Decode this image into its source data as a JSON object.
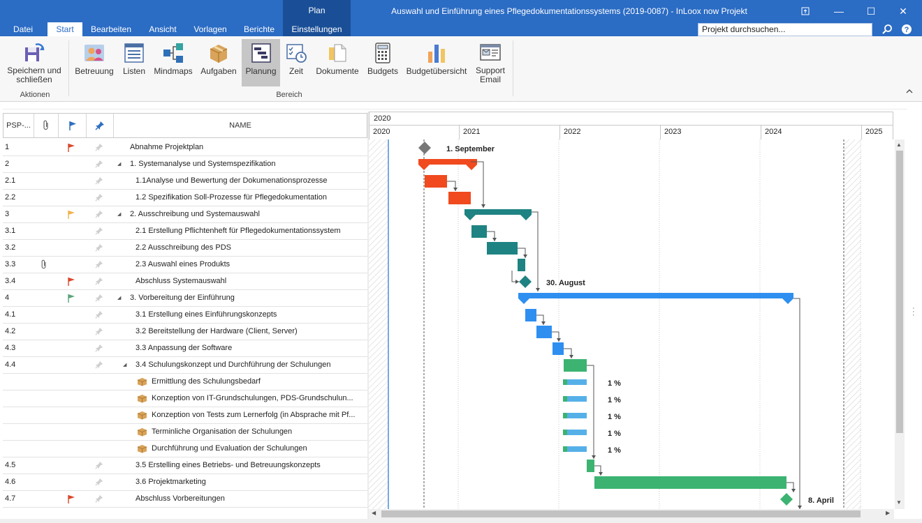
{
  "window": {
    "title": "Auswahl und Einführung eines Pflegedokumentationssystems (2019-0087) - InLoox now Projekt",
    "context_tab": "Plan",
    "qa_icons": [
      "app-logo-icon",
      "save-icon",
      "refresh-icon",
      "undo-icon",
      "redo-icon",
      "print-icon",
      "customize-icon"
    ],
    "minimize": "—",
    "maximize": "☐",
    "close": "✕",
    "restore": "⧉"
  },
  "tabs": [
    {
      "label": "Datei"
    },
    {
      "label": "Start"
    },
    {
      "label": "Bearbeiten"
    },
    {
      "label": "Ansicht"
    },
    {
      "label": "Vorlagen"
    },
    {
      "label": "Berichte"
    },
    {
      "label": "Einstellungen"
    }
  ],
  "search": {
    "value": "Projekt durchsuchen..."
  },
  "ribbon": {
    "buttons": [
      {
        "label": "Speichern und schließen",
        "icon": "save-close-icon"
      },
      {
        "label": "Betreuung",
        "icon": "people-icon"
      },
      {
        "label": "Listen",
        "icon": "list-icon"
      },
      {
        "label": "Mindmaps",
        "icon": "mindmap-icon"
      },
      {
        "label": "Aufgaben",
        "icon": "task-box-icon"
      },
      {
        "label": "Planung",
        "icon": "gantt-icon"
      },
      {
        "label": "Zeit",
        "icon": "time-icon"
      },
      {
        "label": "Dokumente",
        "icon": "document-icon"
      },
      {
        "label": "Budgets",
        "icon": "calculator-icon"
      },
      {
        "label": "Budgetübersicht",
        "icon": "bar-chart-icon"
      },
      {
        "label": "Support Email",
        "icon": "support-email-icon"
      }
    ],
    "groups": {
      "actions": "Aktionen",
      "area": "Bereich"
    }
  },
  "grid": {
    "headers": {
      "psp": "PSP-...",
      "name": "NAME"
    },
    "rows": [
      {
        "psp": "1",
        "name": "Abnahme Projektplan",
        "flag": "#d9482b",
        "level": 0
      },
      {
        "psp": "2",
        "name": "1. Systemanalyse und Systemspezifikation",
        "level": 0,
        "group": true
      },
      {
        "psp": "2.1",
        "name": "1.1Analyse und Bewertung der Dokumenationsprozesse",
        "level": 1
      },
      {
        "psp": "2.2",
        "name": "1.2 Spezifikation Soll-Prozesse für Pflegedokumentation",
        "level": 1
      },
      {
        "psp": "3",
        "name": "2. Ausschreibung und Systemauswahl",
        "flag": "#f0b24b",
        "level": 0,
        "group": true
      },
      {
        "psp": "3.1",
        "name": "2.1 Erstellung Pflichtenheft für Pflegedokumentationssystem",
        "level": 1
      },
      {
        "psp": "3.2",
        "name": "2.2 Ausschreibung des PDS",
        "level": 1
      },
      {
        "psp": "3.3",
        "name": "2.3 Auswahl eines Produkts",
        "level": 1,
        "attachment": true
      },
      {
        "psp": "3.4",
        "name": "Abschluss Systemauswahl",
        "flag": "#d9482b",
        "level": 1
      },
      {
        "psp": "4",
        "name": "3. Vorbereitung der Einführung",
        "flag": "#5aa37a",
        "level": 0,
        "group": true
      },
      {
        "psp": "4.1",
        "name": "3.1 Erstellung eines Einführungskonzepts",
        "level": 1
      },
      {
        "psp": "4.2",
        "name": "3.2 Bereitstellung der Hardware (Client, Server)",
        "level": 1
      },
      {
        "psp": "4.3",
        "name": "3.3 Anpassung der Software",
        "level": 1
      },
      {
        "psp": "4.4",
        "name": "3.4 Schulungskonzept und Durchführung der Schulungen",
        "level": 1,
        "group": true
      },
      {
        "psp": "",
        "name": "Ermittlung des Schulungsbedarf",
        "level": 2,
        "task": true
      },
      {
        "psp": "",
        "name": "Konzeption von IT-Grundschulungen, PDS-Grundschulun...",
        "level": 2,
        "task": true
      },
      {
        "psp": "",
        "name": "Konzeption von Tests zum Lernerfolg (in Absprache mit Pf...",
        "level": 2,
        "task": true
      },
      {
        "psp": "",
        "name": "Terminliche Organisation der Schulungen",
        "level": 2,
        "task": true
      },
      {
        "psp": "",
        "name": "Durchführung und Evaluation der Schulungen",
        "level": 2,
        "task": true
      },
      {
        "psp": "4.5",
        "name": "3.5 Erstelling eines Betriebs- und Betreuungskonzepts",
        "level": 1
      },
      {
        "psp": "4.6",
        "name": "3.6 Projektmarketing",
        "level": 1
      },
      {
        "psp": "4.7",
        "name": "Abschluss Vorbereitungen",
        "flag": "#d9482b",
        "level": 1
      }
    ]
  },
  "timeline": {
    "top_label": "2020",
    "years": [
      "2020",
      "2021",
      "2022",
      "2023",
      "2024",
      "2025"
    ]
  },
  "gantt": {
    "milestone_labels": [
      "1. September",
      "30. August",
      "8. April"
    ],
    "percent_labels": [
      "1 %",
      "1 %",
      "1 %",
      "1 %",
      "1 %"
    ],
    "colors": {
      "red": "#f04a1e",
      "teal": "#1e8382",
      "blue": "#2e8ff0",
      "green": "#3cb371",
      "milestone_gray": "#777777"
    }
  }
}
